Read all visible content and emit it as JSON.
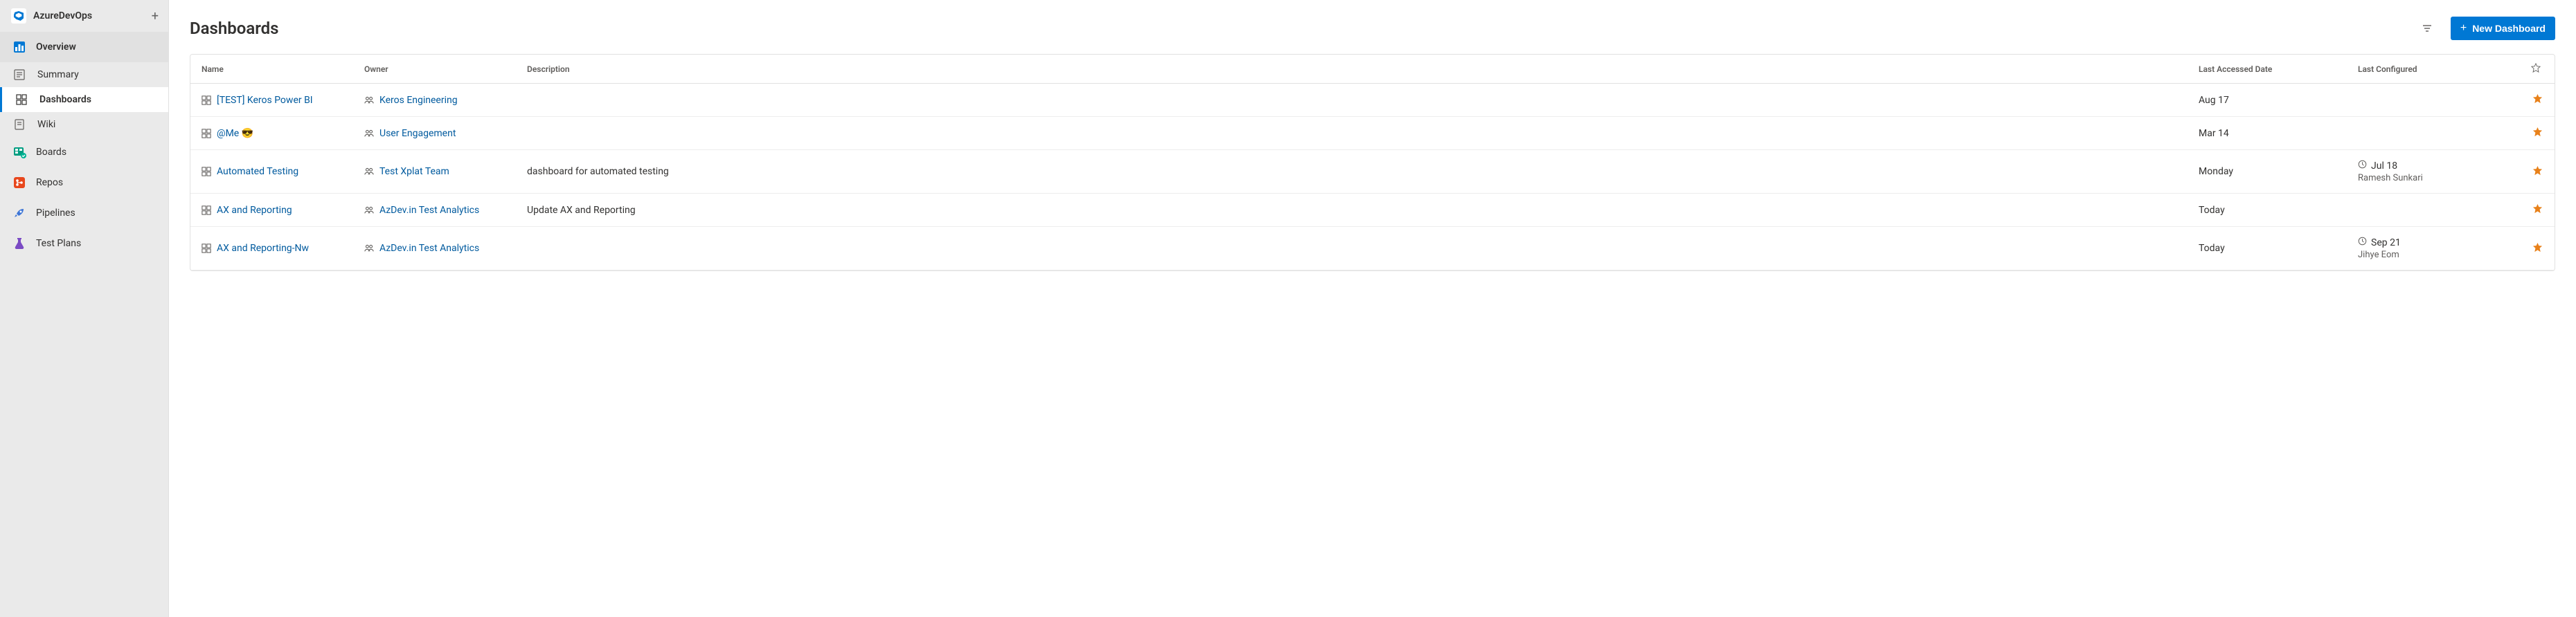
{
  "project": {
    "name": "AzureDevOps"
  },
  "sidebar": {
    "items": [
      {
        "label": "Overview",
        "icon": "overview-icon"
      },
      {
        "label": "Summary",
        "icon": "summary-icon"
      },
      {
        "label": "Dashboards",
        "icon": "dashboards-icon"
      },
      {
        "label": "Wiki",
        "icon": "wiki-icon"
      },
      {
        "label": "Boards",
        "icon": "boards-icon"
      },
      {
        "label": "Repos",
        "icon": "repos-icon"
      },
      {
        "label": "Pipelines",
        "icon": "pipelines-icon"
      },
      {
        "label": "Test Plans",
        "icon": "testplans-icon"
      }
    ]
  },
  "page": {
    "title": "Dashboards"
  },
  "toolbar": {
    "new_dashboard_label": "New Dashboard"
  },
  "table": {
    "headers": {
      "name": "Name",
      "owner": "Owner",
      "description": "Description",
      "last_accessed": "Last Accessed Date",
      "last_configured": "Last Configured"
    },
    "rows": [
      {
        "name": "[TEST] Keros Power BI",
        "owner": "Keros Engineering",
        "description": "",
        "last_accessed": "Aug 17",
        "configured_date": "",
        "configured_by": ""
      },
      {
        "name": "@Me 😎",
        "owner": "User Engagement",
        "description": "",
        "last_accessed": "Mar 14",
        "configured_date": "",
        "configured_by": ""
      },
      {
        "name": "Automated Testing",
        "owner": "Test Xplat Team",
        "description": "dashboard for automated testing",
        "last_accessed": "Monday",
        "configured_date": "Jul 18",
        "configured_by": "Ramesh Sunkari"
      },
      {
        "name": "AX and Reporting",
        "owner": "AzDev.in Test Analytics",
        "description": "Update AX and Reporting",
        "last_accessed": "Today",
        "configured_date": "",
        "configured_by": ""
      },
      {
        "name": "AX and Reporting-Nw",
        "owner": "AzDev.in Test Analytics",
        "description": "",
        "last_accessed": "Today",
        "configured_date": "Sep 21",
        "configured_by": "Jihye Eom"
      }
    ]
  }
}
